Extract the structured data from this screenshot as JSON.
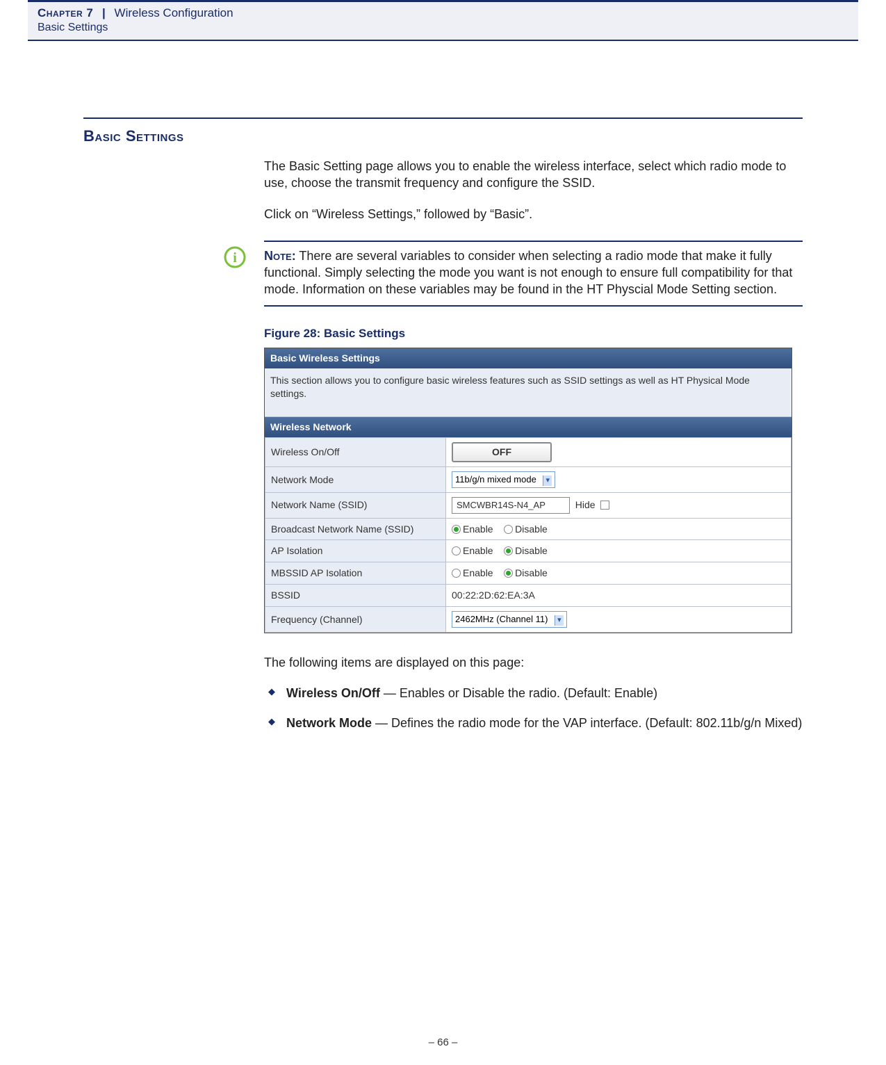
{
  "header": {
    "chapter": "Chapter 7",
    "separator": "|",
    "title": "Wireless Configuration",
    "subtitle": "Basic Settings"
  },
  "section": {
    "heading": "Basic Settings",
    "intro1": "The Basic Setting page allows you to enable the wireless interface, select which radio mode to use, choose the transmit frequency and configure the SSID.",
    "intro2": "Click on “Wireless Settings,” followed by “Basic”."
  },
  "note": {
    "label": "Note:",
    "text": " There are several variables to consider when selecting a radio mode that make it fully functional. Simply selecting the mode you want is not enough to ensure full compatibility for that mode. Information on these variables may be found in the HT Physcial Mode Setting section."
  },
  "figure": {
    "caption": "Figure 28:  Basic Settings",
    "panel_title": "Basic Wireless Settings",
    "panel_desc": "This section allows you to configure basic wireless features such as SSID settings as well as HT Physical Mode settings.",
    "subpanel_title": "Wireless Network",
    "rows": {
      "wireless_onoff_label": "Wireless On/Off",
      "wireless_onoff_value": "OFF",
      "netmode_label": "Network Mode",
      "netmode_value": "11b/g/n mixed mode",
      "ssid_label": "Network Name (SSID)",
      "ssid_value": "SMCWBR14S-N4_AP",
      "ssid_hide_label": "Hide",
      "broadcast_label": "Broadcast Network Name (SSID)",
      "enable_text": "Enable",
      "disable_text": "Disable",
      "apiso_label": "AP Isolation",
      "mbssid_label": "MBSSID AP Isolation",
      "bssid_label": "BSSID",
      "bssid_value": "00:22:2D:62:EA:3A",
      "freq_label": "Frequency (Channel)",
      "freq_value": "2462MHz (Channel 11)"
    }
  },
  "items": {
    "intro": "The following items are displayed on this page:",
    "list": [
      {
        "term": "Wireless On/Off",
        "desc": " — Enables or Disable the radio. (Default: Enable)"
      },
      {
        "term": "Network Mode",
        "desc": " — Defines the radio mode for the VAP interface. (Default: 802.11b/g/n Mixed)"
      }
    ]
  },
  "footer": {
    "page": "–  66  –"
  }
}
